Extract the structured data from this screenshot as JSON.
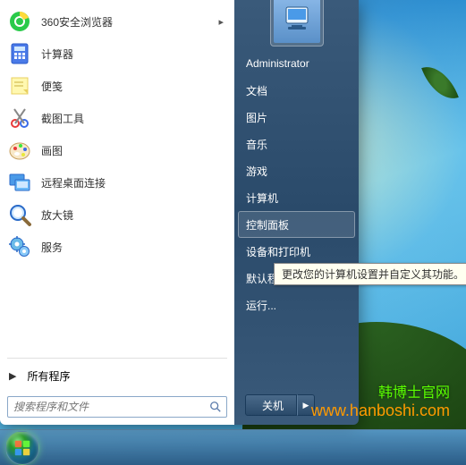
{
  "programs": [
    {
      "label": "360安全浏览器",
      "icon": "browser-360",
      "hasArrow": true
    },
    {
      "label": "计算器",
      "icon": "calculator",
      "hasArrow": false
    },
    {
      "label": "便笺",
      "icon": "sticky-notes",
      "hasArrow": false
    },
    {
      "label": "截图工具",
      "icon": "snipping-tool",
      "hasArrow": false
    },
    {
      "label": "画图",
      "icon": "paint",
      "hasArrow": false
    },
    {
      "label": "远程桌面连接",
      "icon": "remote-desktop",
      "hasArrow": false
    },
    {
      "label": "放大镜",
      "icon": "magnifier",
      "hasArrow": false
    },
    {
      "label": "服务",
      "icon": "services",
      "hasArrow": false
    }
  ],
  "allPrograms": "所有程序",
  "searchPlaceholder": "搜索程序和文件",
  "rightItems": [
    {
      "label": "Administrator",
      "selected": false
    },
    {
      "label": "文档",
      "selected": false
    },
    {
      "label": "图片",
      "selected": false
    },
    {
      "label": "音乐",
      "selected": false
    },
    {
      "label": "游戏",
      "selected": false
    },
    {
      "label": "计算机",
      "selected": false
    },
    {
      "label": "控制面板",
      "selected": true
    },
    {
      "label": "设备和打印机",
      "selected": false
    },
    {
      "label": "默认程序",
      "selected": false
    },
    {
      "label": "运行...",
      "selected": false
    }
  ],
  "shutdownLabel": "关机",
  "tooltip": "更改您的计算机设置并自定义其功能。",
  "watermark": {
    "line1": "韩博士官网",
    "line2": "www.hanboshi.com"
  }
}
